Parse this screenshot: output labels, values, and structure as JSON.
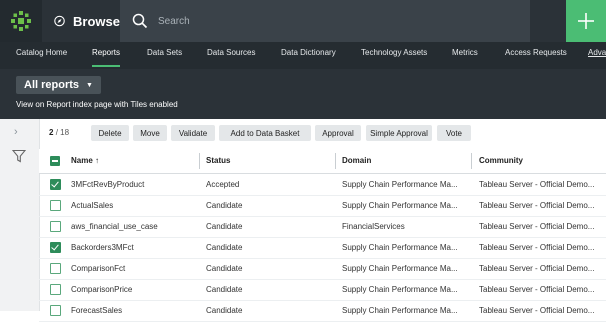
{
  "header": {
    "browse_label": "Browse",
    "search_placeholder": "Search",
    "icons": {
      "logo": "alation-logo-icon",
      "browse": "compass-icon",
      "search": "search-icon",
      "add": "plus-icon"
    }
  },
  "nav": {
    "items": [
      {
        "label": "Catalog Home"
      },
      {
        "label": "Reports",
        "active": true
      },
      {
        "label": "Data Sets"
      },
      {
        "label": "Data Sources"
      },
      {
        "label": "Data Dictionary"
      },
      {
        "label": "Technology Assets"
      },
      {
        "label": "Metrics"
      },
      {
        "label": "Access Requests"
      },
      {
        "label": "Adva"
      }
    ]
  },
  "view": {
    "selector_label": "All reports",
    "description": "View on Report index page with Tiles enabled"
  },
  "toolbar": {
    "selected": "2",
    "total": "/ 18",
    "buttons": [
      "Delete",
      "Move",
      "Validate",
      "Add to Data Basket",
      "Approval",
      "Simple Approval",
      "Vote"
    ]
  },
  "table": {
    "columns": [
      "Name ↑",
      "Status",
      "Domain",
      "Community"
    ],
    "rows": [
      {
        "checked": true,
        "name": "3MFctRevByProduct",
        "status": "Accepted",
        "domain": "Supply Chain Performance Ma...",
        "community": "Tableau Server - Official Demo..."
      },
      {
        "checked": false,
        "name": "ActualSales",
        "status": "Candidate",
        "domain": "Supply Chain Performance Ma...",
        "community": "Tableau Server - Official Demo..."
      },
      {
        "checked": false,
        "name": "aws_financial_use_case",
        "status": "Candidate",
        "domain": "FinancialServices",
        "community": "Tableau Server - Official Demo..."
      },
      {
        "checked": true,
        "name": "Backorders3MFct",
        "status": "Candidate",
        "domain": "Supply Chain Performance Ma...",
        "community": "Tableau Server - Official Demo..."
      },
      {
        "checked": false,
        "name": "ComparisonFct",
        "status": "Candidate",
        "domain": "Supply Chain Performance Ma...",
        "community": "Tableau Server - Official Demo..."
      },
      {
        "checked": false,
        "name": "ComparisonPrice",
        "status": "Candidate",
        "domain": "Supply Chain Performance Ma...",
        "community": "Tableau Server - Official Demo..."
      },
      {
        "checked": false,
        "name": "ForecastSales",
        "status": "Candidate",
        "domain": "Supply Chain Performance Ma...",
        "community": "Tableau Server - Official Demo..."
      }
    ]
  },
  "colors": {
    "accent": "#4bbd74",
    "topbar": "#2b3238",
    "checkbox": "#2d8c5a"
  }
}
